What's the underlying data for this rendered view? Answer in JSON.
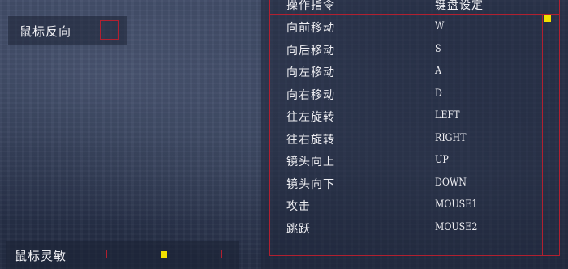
{
  "options": {
    "invert_mouse_label": "鼠标反向",
    "invert_mouse_checked": false,
    "sensitivity_label": "鼠标灵敏",
    "sensitivity_value": 0.5
  },
  "keybindings": {
    "header_command": "操作指令",
    "header_key": "键盘设定",
    "rows": [
      {
        "command": "向前移动",
        "key": "W"
      },
      {
        "command": "向后移动",
        "key": "S"
      },
      {
        "command": "向左移动",
        "key": "A"
      },
      {
        "command": "向右移动",
        "key": "D"
      },
      {
        "command": "往左旋转",
        "key": "LEFT"
      },
      {
        "command": "往右旋转",
        "key": "RIGHT"
      },
      {
        "command": "镜头向上",
        "key": "UP"
      },
      {
        "command": "镜头向下",
        "key": "DOWN"
      },
      {
        "command": "攻击",
        "key": "MOUSE1"
      },
      {
        "command": "跳跃",
        "key": "MOUSE2"
      }
    ]
  },
  "colors": {
    "frame_red": "#b22030",
    "accent_yellow": "#f2e000"
  }
}
